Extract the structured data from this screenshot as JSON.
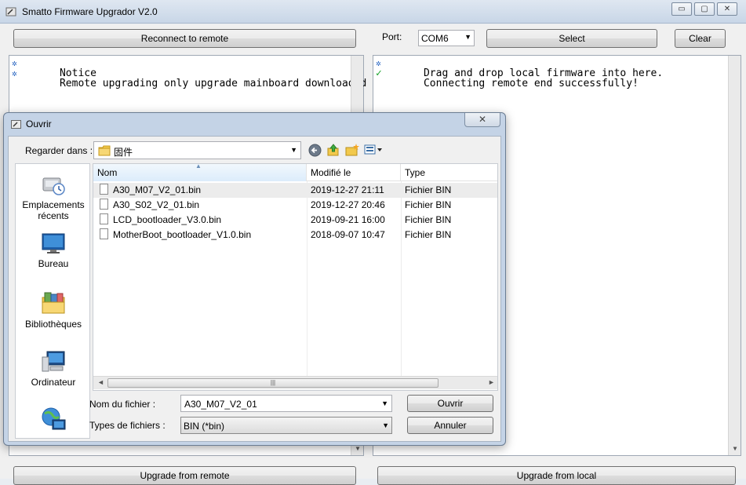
{
  "window": {
    "title": "Smatto Firmware Upgrador V2.0",
    "minimize_glyph": "▭",
    "maximize_glyph": "▢",
    "close_glyph": "✕"
  },
  "toolbar": {
    "reconnect_label": "Reconnect to remote",
    "port_label": "Port:",
    "port_value": "COM6",
    "select_label": "Select",
    "clear_label": "Clear"
  },
  "left_console": {
    "lines": [
      "Notice",
      "Remote upgrading only upgrade mainboard downloaded"
    ]
  },
  "right_console": {
    "lines": [
      "Drag and drop local firmware into here.",
      "Connecting remote end successfully!"
    ]
  },
  "bottom": {
    "upgrade_remote_label": "Upgrade from remote",
    "upgrade_local_label": "Upgrade from local"
  },
  "dialog": {
    "title": "Ouvrir",
    "close_glyph": "✕",
    "look_in_label": "Regarder dans :",
    "look_in_value": "固件",
    "places": [
      {
        "label": "Emplacements récents",
        "icon": "recent-places-icon"
      },
      {
        "label": "Bureau",
        "icon": "desktop-icon"
      },
      {
        "label": "Bibliothèques",
        "icon": "libraries-icon"
      },
      {
        "label": "Ordinateur",
        "icon": "computer-icon"
      },
      {
        "label": "",
        "icon": "network-icon"
      }
    ],
    "columns": {
      "name": "Nom",
      "modified": "Modifié le",
      "type": "Type"
    },
    "files": [
      {
        "name": "A30_M07_V2_01.bin",
        "modified": "2019-12-27 21:11",
        "type": "Fichier BIN"
      },
      {
        "name": "A30_S02_V2_01.bin",
        "modified": "2019-12-27 20:46",
        "type": "Fichier BIN"
      },
      {
        "name": "LCD_bootloader_V3.0.bin",
        "modified": "2019-09-21 16:00",
        "type": "Fichier BIN"
      },
      {
        "name": "MotherBoot_bootloader_V1.0.bin",
        "modified": "2018-09-07 10:47",
        "type": "Fichier BIN"
      }
    ],
    "filename_label": "Nom du fichier :",
    "filename_value": "A30_M07_V2_01",
    "filetype_label": "Types de fichiers :",
    "filetype_value": "BIN (*bin)",
    "open_label": "Ouvrir",
    "cancel_label": "Annuler"
  }
}
